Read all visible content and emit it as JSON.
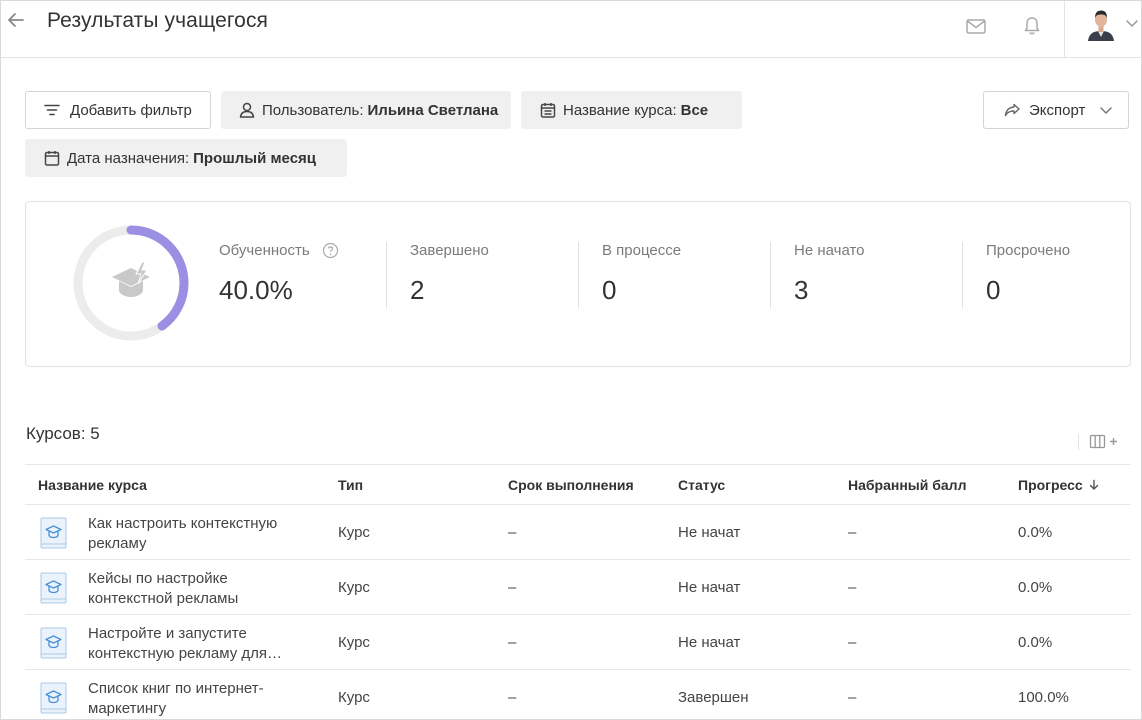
{
  "header": {
    "title": "Результаты учащегося",
    "icons": [
      "back-arrow-icon",
      "mail-icon",
      "bell-icon",
      "chevron-down-icon"
    ]
  },
  "filters": {
    "add_filter": "Добавить фильтр",
    "user": {
      "label": "Пользователь:",
      "value": "Ильина Светлана"
    },
    "course": {
      "label": "Название курса:",
      "value": "Все"
    },
    "date": {
      "label": "Дата назначения:",
      "value": "Прошлый месяц"
    },
    "export": "Экспорт"
  },
  "stats": {
    "proficiency": {
      "label": "Обученность",
      "value": "40.0%",
      "fraction": 0.4
    },
    "completed": {
      "label": "Завершено",
      "value": "2"
    },
    "in_progress": {
      "label": "В процессе",
      "value": "0"
    },
    "not_started": {
      "label": "Не начато",
      "value": "3"
    },
    "overdue": {
      "label": "Просрочено",
      "value": "0"
    }
  },
  "table": {
    "count_title": "Курсов: 5",
    "columns": [
      "Название курса",
      "Тип",
      "Срок выполнения",
      "Статус",
      "Набранный балл",
      "Прогресс"
    ],
    "rows": [
      {
        "name": "Как настроить контекстную рекламу",
        "type": "Курс",
        "deadline": "–",
        "status": "Не начат",
        "score": "–",
        "progress": "0.0%"
      },
      {
        "name": "Кейсы по настройке контекстной рекламы",
        "type": "Курс",
        "deadline": "–",
        "status": "Не начат",
        "score": "–",
        "progress": "0.0%"
      },
      {
        "name": "Настройте и запустите контекстную рекламу для…",
        "type": "Курс",
        "deadline": "–",
        "status": "Не начат",
        "score": "–",
        "progress": "0.0%"
      },
      {
        "name": "Список книг по интернет-маркетингу",
        "type": "Курс",
        "deadline": "–",
        "status": "Завершен",
        "score": "–",
        "progress": "100.0%"
      }
    ]
  },
  "colors": {
    "accent": "#9b8fe3",
    "track": "#ececec",
    "course_icon": "#4a90d9"
  }
}
